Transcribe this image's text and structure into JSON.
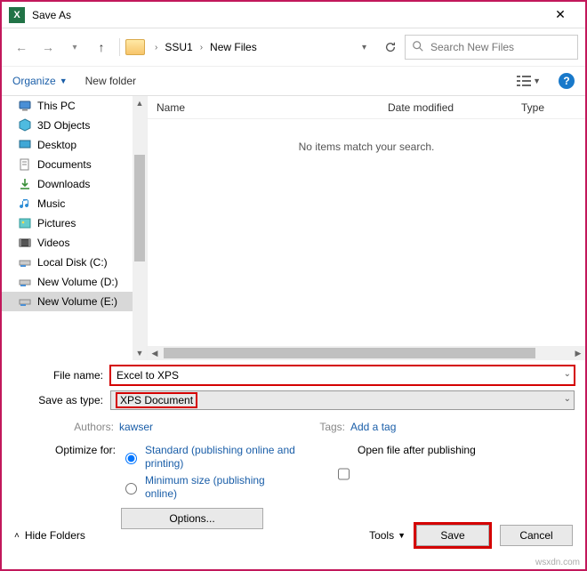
{
  "window": {
    "title": "Save As"
  },
  "breadcrumb": {
    "seg1": "SSU1",
    "seg2": "New Files"
  },
  "search": {
    "placeholder": "Search New Files"
  },
  "toolbar": {
    "organize": "Organize",
    "new_folder": "New folder"
  },
  "tree": {
    "items": [
      {
        "label": "This PC"
      },
      {
        "label": "3D Objects"
      },
      {
        "label": "Desktop"
      },
      {
        "label": "Documents"
      },
      {
        "label": "Downloads"
      },
      {
        "label": "Music"
      },
      {
        "label": "Pictures"
      },
      {
        "label": "Videos"
      },
      {
        "label": "Local Disk (C:)"
      },
      {
        "label": "New Volume (D:)"
      },
      {
        "label": "New Volume (E:)"
      }
    ]
  },
  "columns": {
    "name": "Name",
    "date": "Date modified",
    "type": "Type"
  },
  "empty_msg": "No items match your search.",
  "form": {
    "filename_label": "File name:",
    "filename_value": "Excel to XPS",
    "type_label": "Save as type:",
    "type_value": "XPS Document"
  },
  "meta": {
    "authors_label": "Authors:",
    "authors_value": "kawser",
    "tags_label": "Tags:",
    "tags_value": "Add a tag"
  },
  "optimize": {
    "label": "Optimize for:",
    "standard": "Standard (publishing online and printing)",
    "minimum": "Minimum size (publishing online)",
    "open_after": "Open file after publishing",
    "options_btn": "Options..."
  },
  "footer": {
    "hide": "Hide Folders",
    "tools": "Tools",
    "save": "Save",
    "cancel": "Cancel"
  },
  "watermark": "wsxdn.com"
}
